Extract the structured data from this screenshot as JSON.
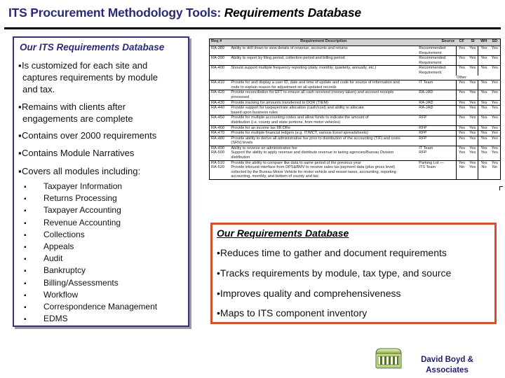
{
  "title": {
    "main": "ITS Procurement Methodology Tools:",
    "sub": "Requirements Database"
  },
  "left_box": {
    "heading": "Our ITS Requirements Database",
    "points": [
      "Is customized for each site and captures requirements by module and tax.",
      "Remains with clients after engagements are complete",
      "Contains over 2000 requirements",
      "Contains Module Narratives",
      "Covers all modules including:"
    ],
    "point_lines": [
      [
        "Is customized for each site and",
        "captures requirements by module",
        "and tax."
      ],
      [
        "Remains with clients after",
        "engagements are complete"
      ],
      [
        "Contains over 2000 requirements"
      ],
      [
        "Contains Module Narratives"
      ],
      [
        "Covers all modules including:"
      ]
    ],
    "bullet": "▪",
    "modules": [
      "Taxpayer Information",
      "Returns Processing",
      "Taxpayer Accounting",
      "Revenue Accounting",
      "Collections",
      "Appeals",
      "Audit",
      "Bankruptcy",
      "Billing/Assessments",
      "Workflow",
      "Correspondence Management",
      "EDMS"
    ]
  },
  "requirements_table": {
    "headers": [
      "Req #",
      "Requirement Description",
      "Source",
      "CF",
      "SI",
      "WH",
      "SD"
    ],
    "rows": [
      {
        "id": "RA-380",
        "desc": [
          "Ability to drill down to view details of revenue, accounts and returns"
        ],
        "source": [
          "Recommended",
          "Requirement"
        ],
        "vals": [
          "Yes",
          "Yes",
          "Yes",
          "Yes"
        ]
      },
      {
        "id": "RA-390",
        "desc": [
          "Ability to report by filing period, collection period and billing period"
        ],
        "source": [
          "Recommended",
          "Requirement"
        ],
        "vals": [
          "Yes",
          "Yes",
          "Yes",
          "Yes"
        ]
      },
      {
        "id": "RA-400",
        "desc": [
          "Should support multiple frequency reporting (daily, monthly, quarterly, annually, etc.)"
        ],
        "source": [
          "Recommended",
          "Requirement"
        ],
        "vals": [
          "Yes",
          "Yes",
          "Yes",
          "Yes"
        ]
      },
      {
        "other": "Other"
      },
      {
        "id": "RA-410",
        "desc": [
          "Provide for and display a user ID, date and time of update and code for source of information and",
          "code to explain reason for adjustment on all updated records"
        ],
        "source": [
          "IT Team"
        ],
        "vals": [
          "Yes",
          "Yes",
          "Yes",
          "Yes"
        ]
      },
      {
        "id": "RA-420",
        "desc": [
          "Provide reconciliation for EFT to ensure all cash received (money taken) and account receipts",
          "processed"
        ],
        "source": [
          "RA-JAD"
        ],
        "vals": [
          "Yes",
          "Yes",
          "Yes",
          "Yes"
        ]
      },
      {
        "id": "RA-430",
        "desc": [
          "Provide tracking for amounts transferred to DOR (TIEM)"
        ],
        "source": [
          "RA-JAD"
        ],
        "vals": [
          "Yes",
          "Yes",
          "Yes",
          "Yes"
        ]
      },
      {
        "id": "RA-440",
        "desc": [
          "Provide support for taxpayer/rate allocation (cash/cost) and ability to allocate",
          "based upon business rules"
        ],
        "source": [
          "RA-JAD"
        ],
        "vals": [
          "Yes",
          "Yes",
          "Yes",
          "Yes"
        ]
      },
      {
        "id": "RA-450",
        "desc": [
          "Provide for multiple accounting codes and allow funds to indicate the amount of",
          "distribution (i.e. county and state portions, from motor vehicles)"
        ],
        "source": [
          "RFP"
        ],
        "vals": [
          "Yes",
          "Yes",
          "Yes",
          "Yes"
        ]
      },
      {
        "id": "RA-460",
        "desc": [
          "Provide for an income tax IIB DRe"
        ],
        "source": [
          "RFP"
        ],
        "vals": [
          "Yes",
          "Yes",
          "Yes",
          "Yes"
        ]
      },
      {
        "id": "RA-470",
        "desc": [
          "Provide for multiple financial ledgers (e.g. IT/MCT, various Excel spreadsheets)"
        ],
        "source": [
          "RFP"
        ],
        "vals": [
          "Yes",
          "Yes",
          "Yes",
          "Yes"
        ]
      },
      {
        "id": "RA-480",
        "desc": [
          "Provide ability to derive all administrative fee prior to distribution of the accounting (TIF) and costs",
          "(SRV) levels"
        ],
        "source": [
          "RFP"
        ],
        "vals": [
          "Yes",
          "Yes",
          "Yes",
          "Yes"
        ]
      },
      {
        "id": "RA-490",
        "desc": [
          "Ability to reverse an administrative fee",
          "Support the ability to apply revenue and distribute revenue to taxing agencies/Bureau Division",
          "distribution"
        ],
        "source": [
          "IT Team",
          "RFP"
        ],
        "vals": [
          "Yes",
          "Yes",
          "Yes",
          "Yes"
        ],
        "vals2": [
          "Yes",
          "Yes",
          "Yes",
          "Yes"
        ],
        "id2": "RA-500"
      },
      {
        "id": "RA-510",
        "desc": [
          "Provide the ability to compare like data to same period of the previous year",
          "Provide inbound interface from DPS&BMV to receive sales tax payment data (plus gross level)",
          "collected by the Bureau Motor Vehicle for motor vehicle and vessel taxes, accounting, reporting",
          "accounting, monthly, and bottom of county and tax"
        ],
        "source": [
          "Parking Lot —",
          "ITS Team"
        ],
        "vals": [
          "Yes",
          "Yes",
          "Yes",
          "Yes"
        ],
        "vals2": [
          "No",
          "Yes",
          "No",
          "No"
        ],
        "id2": "RA-520"
      }
    ]
  },
  "right_box": {
    "heading": "Our Requirements Database",
    "bullet": "•",
    "points": [
      "Reduces time to gather and document requirements",
      "Tracks requirements by module, tax type, and source",
      "Improves quality and comprehensiveness",
      "Maps to ITS component inventory"
    ]
  },
  "footer": {
    "logo_icon": "building-columns-icon",
    "company_lines": [
      "David Boyd &",
      "Associates"
    ]
  },
  "colors": {
    "title_blue": "#2b2a78",
    "left_border": "#353082",
    "right_border": "#d4502a",
    "company_text": "#1e1e6e"
  }
}
